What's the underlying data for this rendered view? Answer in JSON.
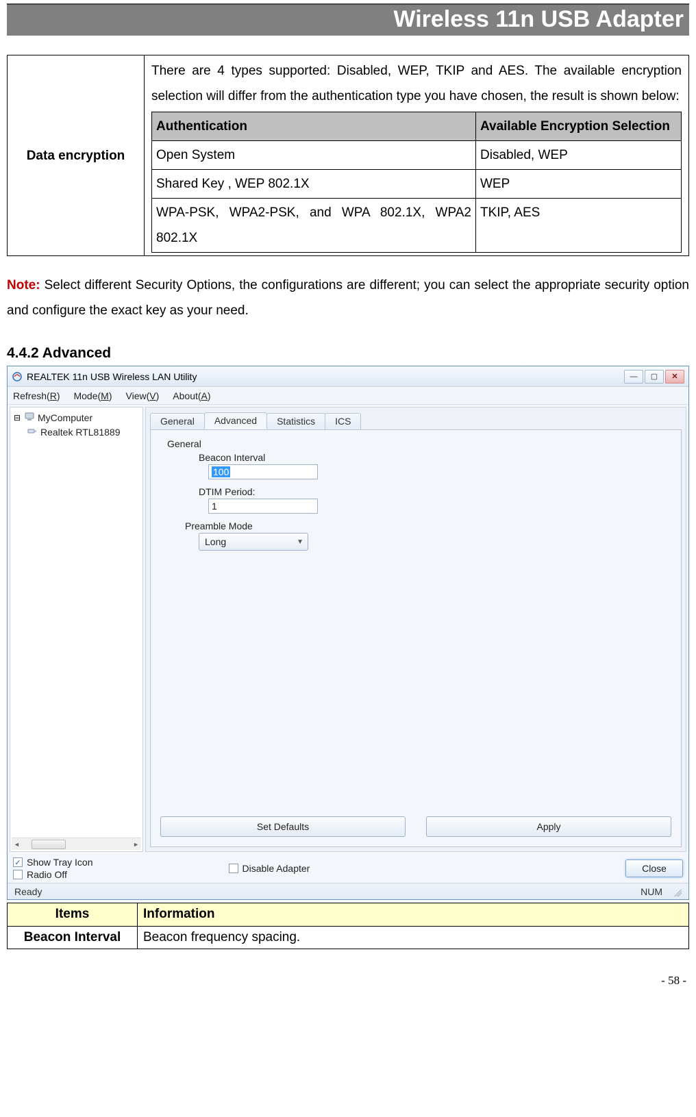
{
  "header": {
    "title": "Wireless 11n USB Adapter"
  },
  "enc": {
    "label": "Data encryption",
    "intro": "There are 4 types supported: Disabled, WEP, TKIP and AES. The available encryption selection will differ from the authentication type you have chosen, the result is shown below:",
    "head_auth": "Authentication",
    "head_enc": "Available Encryption Selection",
    "rows": [
      {
        "auth": "Open System",
        "enc": "Disabled, WEP"
      },
      {
        "auth": "Shared Key , WEP 802.1X",
        "enc": "WEP"
      },
      {
        "auth": "WPA-PSK, WPA2-PSK, and WPA 802.1X, WPA2 802.1X",
        "enc": "TKIP, AES"
      }
    ]
  },
  "note": {
    "label": "Note:",
    "body": " Select different Security Options, the configurations are different; you can select the appropriate security option and configure the exact key as your need."
  },
  "section": {
    "heading": "4.4.2    Advanced"
  },
  "app": {
    "title": "REALTEK 11n USB Wireless LAN Utility",
    "menu": {
      "refresh": "Refresh(R)",
      "mode": "Mode(M)",
      "view": "View(V)",
      "about": "About(A)"
    },
    "tree": {
      "root": "MyComputer",
      "child": "Realtek RTL81889"
    },
    "tabs": {
      "general": "General",
      "advanced": "Advanced",
      "statistics": "Statistics",
      "ics": "ICS"
    },
    "fields": {
      "group": "General",
      "beacon_label": "Beacon Interval",
      "beacon_value": "100",
      "dtim_label": "DTIM Period:",
      "dtim_value": "1",
      "preamble_label": "Preamble Mode",
      "preamble_value": "Long"
    },
    "buttons": {
      "defaults": "Set Defaults",
      "apply": "Apply",
      "close": "Close"
    },
    "checks": {
      "tray": "Show Tray Icon",
      "radio": "Radio Off",
      "disable": "Disable Adapter"
    },
    "status": {
      "left": "Ready",
      "right": "NUM"
    }
  },
  "info": {
    "h_items": "Items",
    "h_info": "Information",
    "r1_label": "Beacon Interval",
    "r1_body": "Beacon frequency spacing."
  },
  "page_number": "- 58 -"
}
